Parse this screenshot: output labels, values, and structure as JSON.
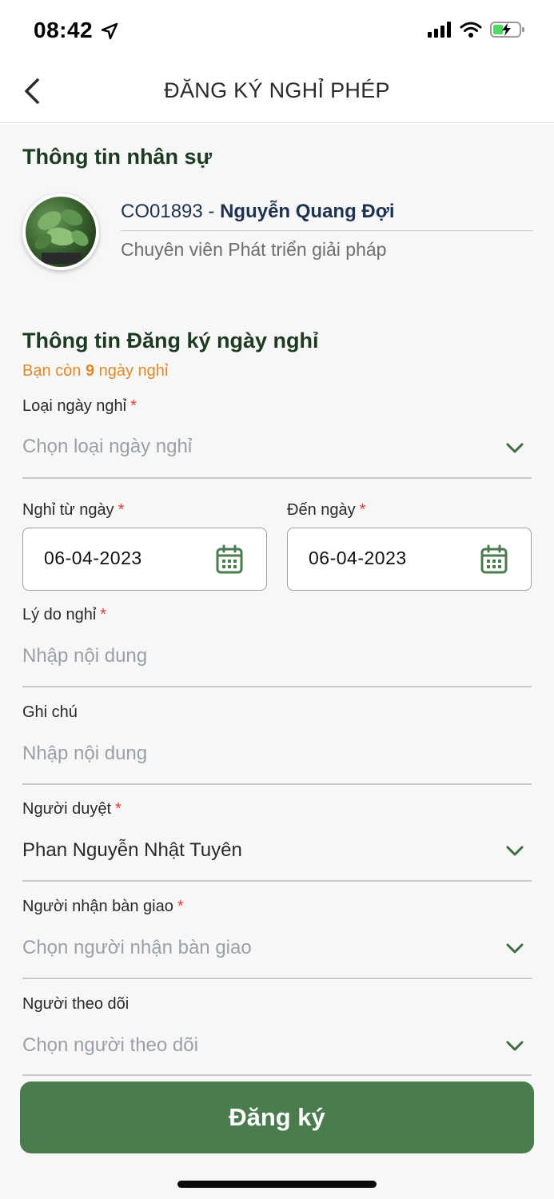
{
  "status_bar": {
    "time": "08:42"
  },
  "header": {
    "title": "ĐĂNG KÝ NGHỈ PHÉP"
  },
  "employee_section": {
    "title": "Thông tin nhân sự",
    "code": "CO01893",
    "separator": " - ",
    "name": "Nguyễn Quang Đợi",
    "position": "Chuyên viên Phát triển giải pháp"
  },
  "leave_section": {
    "title": "Thông tin Đăng ký ngày nghỉ",
    "remaining_prefix": "Bạn còn ",
    "remaining_days": "9",
    "remaining_suffix": " ngày nghỉ"
  },
  "form": {
    "leave_type": {
      "label": "Loại ngày nghỉ",
      "required": "*",
      "placeholder": "Chọn loại ngày nghỉ"
    },
    "from_date": {
      "label": "Nghỉ từ ngày",
      "required": "*",
      "value": "06-04-2023"
    },
    "to_date": {
      "label": "Đến ngày",
      "required": "*",
      "value": "06-04-2023"
    },
    "reason": {
      "label": "Lý do nghỉ",
      "required": "*",
      "placeholder": "Nhập nội dung"
    },
    "note": {
      "label": "Ghi chú",
      "placeholder": "Nhập nội dung"
    },
    "approver": {
      "label": "Người duyệt",
      "required": "*",
      "value": "Phan Nguyễn Nhật Tuyên"
    },
    "handover": {
      "label": "Người nhận bàn giao",
      "required": "*",
      "placeholder": "Chọn người nhận bàn giao"
    },
    "follower": {
      "label": "Người theo dõi",
      "placeholder": "Chọn người theo dõi"
    }
  },
  "submit": {
    "label": "Đăng ký"
  },
  "colors": {
    "primary": "#4a7c4e",
    "accent_orange": "#e0892b",
    "required_red": "#e53935"
  }
}
